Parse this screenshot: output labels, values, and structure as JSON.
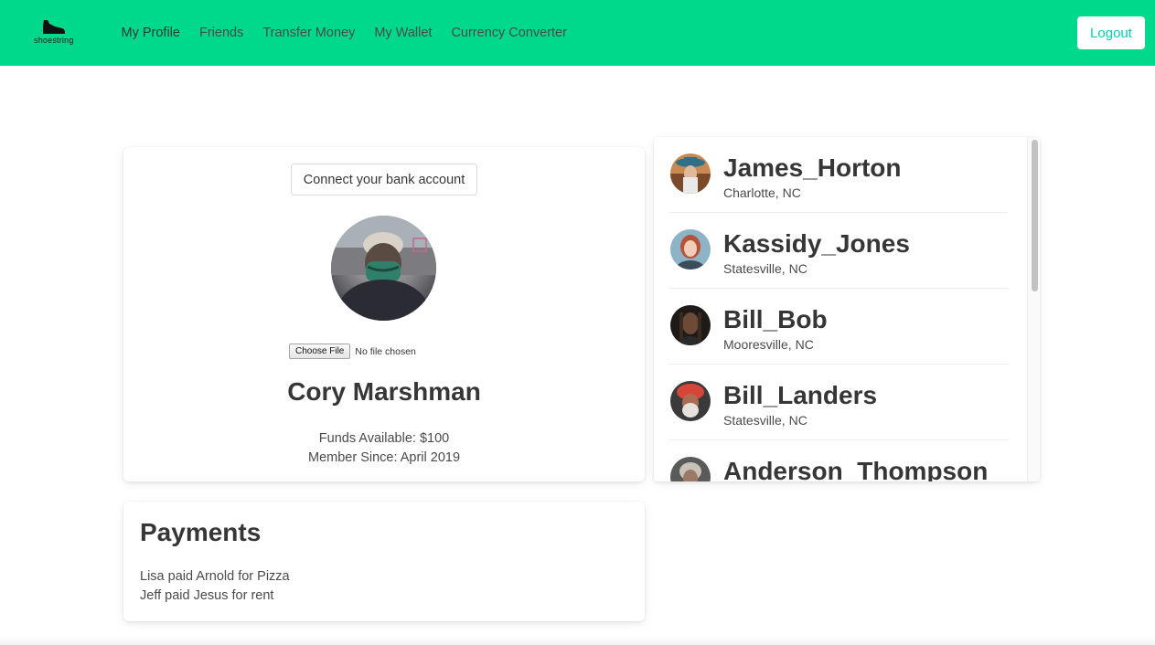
{
  "nav": {
    "brand_text": "shoestring",
    "links": [
      {
        "label": "My Profile"
      },
      {
        "label": "Friends"
      },
      {
        "label": "Transfer Money"
      },
      {
        "label": "My Wallet"
      },
      {
        "label": "Currency Converter"
      }
    ],
    "logout_label": "Logout",
    "colors": {
      "bar": "#00d98b",
      "logout_text": "#00d1b2"
    }
  },
  "profile": {
    "connect_label": "Connect your bank account",
    "file_button_label": "Choose File",
    "file_status": "No file chosen",
    "name": "Cory Marshman",
    "funds": "Funds Available: $100",
    "member_since": "Member Since: April 2019"
  },
  "friends": [
    {
      "name": "James_Horton",
      "location": "Charlotte, NC"
    },
    {
      "name": "Kassidy_Jones",
      "location": "Statesville, NC"
    },
    {
      "name": "Bill_Bob",
      "location": "Mooresville, NC"
    },
    {
      "name": "Bill_Landers",
      "location": "Statesville, NC"
    },
    {
      "name": "Anderson_Thompson",
      "location": ""
    }
  ],
  "payments": {
    "title": "Payments",
    "items": [
      "Lisa paid Arnold for Pizza",
      "Jeff paid Jesus for rent"
    ]
  }
}
